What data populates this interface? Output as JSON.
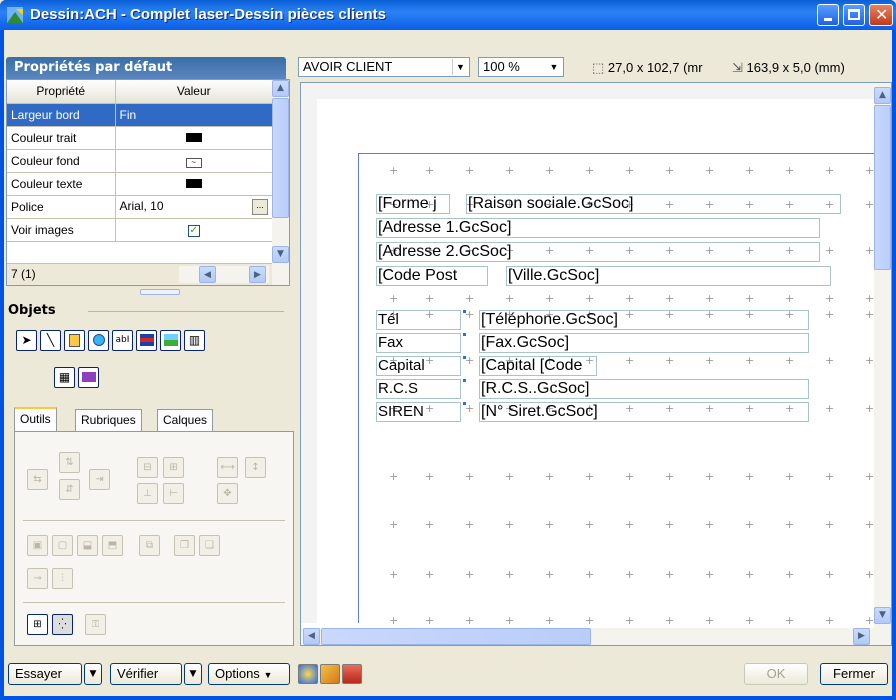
{
  "window": {
    "title": "Dessin:ACH - Complet laser-Dessin pièces clients",
    "colors": {
      "titlebar": "#0a5fd6",
      "selection": "#316ac5",
      "page_border": "#5f7fd1"
    }
  },
  "properties_panel": {
    "header": "Propriétés par défaut",
    "col_property": "Propriété",
    "col_value": "Valeur",
    "rows": [
      {
        "name": "Largeur bord",
        "value": "Fin"
      },
      {
        "name": "Couleur trait",
        "value": ""
      },
      {
        "name": "Couleur fond",
        "value": ""
      },
      {
        "name": "Couleur texte",
        "value": ""
      },
      {
        "name": "Police",
        "value": "Arial, 10"
      },
      {
        "name": "Voir images",
        "value": ""
      }
    ],
    "footer": "7 (1)",
    "ellipsis": "..."
  },
  "objects": {
    "label": "Objets"
  },
  "tabs": [
    "Outils",
    "Rubriques",
    "Calques"
  ],
  "toolbar": {
    "document_select": "AVOIR CLIENT",
    "zoom_select": "100 %",
    "position_readout": "27,0 x 102,7 (mr",
    "size_readout": "163,9 x 5,0 (mm)"
  },
  "design": {
    "forme": "[Forme j",
    "raison": "[Raison sociale.GcSoc]",
    "adresse1": "[Adresse 1.GcSoc]",
    "adresse2": "[Adresse 2.GcSoc]",
    "cp": "[Code Post",
    "ville": "[Ville.GcSoc]",
    "tel_label": "Tél",
    "tel": "[Téléphone.GcSoc]",
    "fax_label": "Fax",
    "fax": "[Fax.GcSoc]",
    "capital_label": "Capital",
    "capital": "[Capital [Code",
    "rcs_label": "R.C.S",
    "rcs": "[R.C.S..GcSoc]",
    "siren_label": "SIREN",
    "siren": "[N° Siret.GcSoc]"
  },
  "bottom": {
    "essayer": "Essayer",
    "verifier": "Vérifier",
    "options": "Options",
    "ok": "OK",
    "fermer": "Fermer"
  }
}
